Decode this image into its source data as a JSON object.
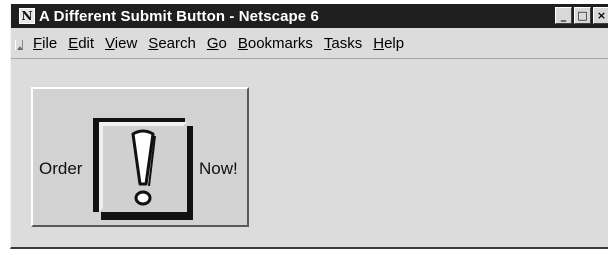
{
  "window": {
    "title": "A Different Submit Button - Netscape 6",
    "app_icon_letter": "N",
    "controls": {
      "minimize": "_",
      "maximize": "□",
      "close": "×"
    }
  },
  "menubar": {
    "items": [
      {
        "accel": "F",
        "rest": "ile"
      },
      {
        "accel": "E",
        "rest": "dit"
      },
      {
        "accel": "V",
        "rest": "iew"
      },
      {
        "accel": "S",
        "rest": "earch"
      },
      {
        "accel": "G",
        "rest": "o"
      },
      {
        "accel": "B",
        "rest": "ookmarks"
      },
      {
        "accel": "T",
        "rest": "asks"
      },
      {
        "accel": "H",
        "rest": "elp"
      }
    ]
  },
  "page": {
    "submit_button": {
      "left_text": "Order",
      "right_text": "Now!",
      "icon": "exclamation-icon"
    }
  },
  "colors": {
    "titlebar": "#1f1f1f",
    "window_bg": "#dcdcdc",
    "button_face": "#d2d2d2"
  }
}
